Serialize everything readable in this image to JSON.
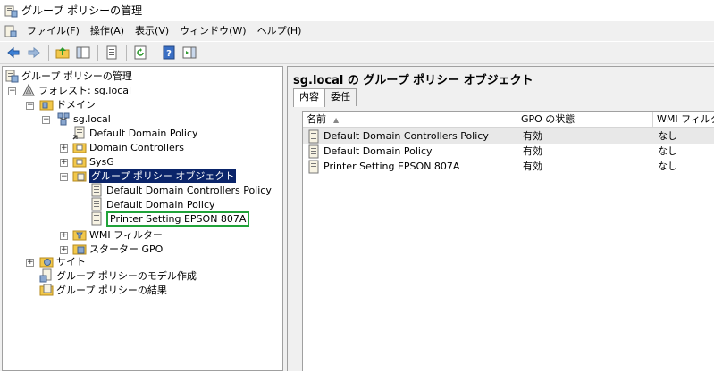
{
  "window": {
    "title": "グループ ポリシーの管理"
  },
  "menu": {
    "items": [
      {
        "label": "ファイル(F)"
      },
      {
        "label": "操作(A)"
      },
      {
        "label": "表示(V)"
      },
      {
        "label": "ウィンドウ(W)"
      },
      {
        "label": "ヘルプ(H)"
      }
    ]
  },
  "toolbar": {
    "buttons": [
      "back-arrow-icon",
      "forward-arrow-icon",
      "up-folder-icon",
      "show-hide-tree-icon",
      "properties-icon",
      "refresh-icon",
      "help-icon",
      "action-pane-icon"
    ]
  },
  "tree": {
    "root": "グループ ポリシーの管理",
    "forest": "フォレスト: sg.local",
    "domains": "ドメイン",
    "domain": "sg.local",
    "default_domain_policy": "Default Domain Policy",
    "domain_controllers": "Domain Controllers",
    "sysg": "SysG",
    "gpo_container": "グループ ポリシー オブジェクト",
    "gpo_ddcp": "Default Domain Controllers Policy",
    "gpo_ddp": "Default Domain Policy",
    "gpo_printer": "Printer Setting EPSON 807A",
    "wmi_filters": "WMI フィルター",
    "starter_gpo": "スターター GPO",
    "sites": "サイト",
    "modeling": "グループ ポリシーのモデル作成",
    "results": "グループ ポリシーの結果"
  },
  "content": {
    "title": "sg.local の グループ ポリシー オブジェクト",
    "tabs": [
      {
        "label": "内容"
      },
      {
        "label": "委任"
      }
    ],
    "columns": {
      "name": "名前",
      "status": "GPO の状態",
      "wmi": "WMI フィルター"
    },
    "rows": [
      {
        "name": "Default Domain Controllers Policy",
        "status": "有効",
        "wmi": "なし"
      },
      {
        "name": "Default Domain Policy",
        "status": "有効",
        "wmi": "なし"
      },
      {
        "name": "Printer Setting EPSON 807A",
        "status": "有効",
        "wmi": "なし"
      }
    ]
  },
  "colors": {
    "selection": "#0a246a",
    "highlight_box": "#21a33a"
  }
}
